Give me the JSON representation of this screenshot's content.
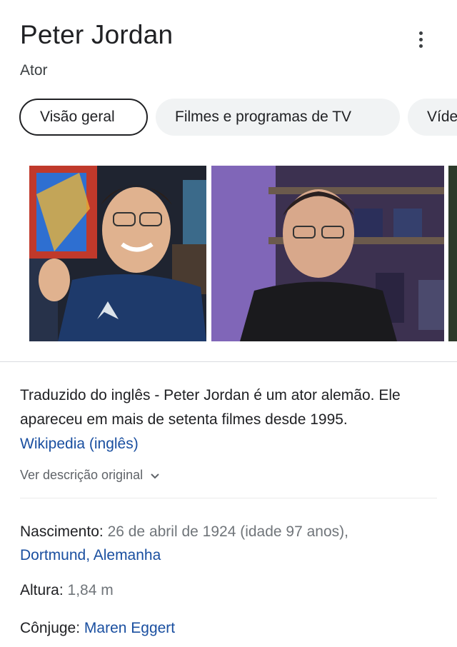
{
  "entity": {
    "name": "Peter Jordan",
    "type": "Ator"
  },
  "menu": {
    "icon": "more-vert-icon"
  },
  "tabs": [
    {
      "label": "Visão geral",
      "active": true
    },
    {
      "label": "Filmes e programas de TV",
      "active": false
    },
    {
      "label": "Víde",
      "active": false
    }
  ],
  "description": {
    "text": "Traduzido do inglês - Peter Jordan é um ator alemão. Ele apareceu em mais de setenta filmes desde 1995.",
    "source_link": "Wikipedia (inglês)",
    "see_original": "Ver descrição original"
  },
  "facts": {
    "birth": {
      "label": "Nascimento:",
      "value": "26 de abril de 1924 (idade 97 anos),",
      "place": "Dortmund, Alemanha"
    },
    "height": {
      "label": "Altura:",
      "value": "1,84 m"
    },
    "spouse": {
      "label": "Cônjuge:",
      "value": "Maren Eggert"
    }
  },
  "colors": {
    "link": "#1a4fa0",
    "chip_inactive": "#f1f3f4",
    "text": "#202124",
    "muted": "#70757a"
  }
}
